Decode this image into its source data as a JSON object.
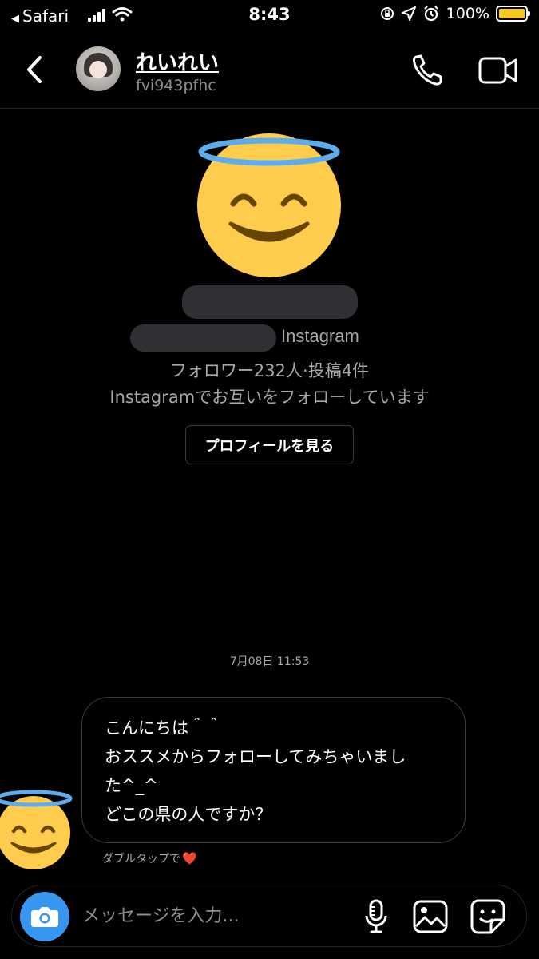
{
  "status_bar": {
    "back_app": "Safari",
    "time": "8:43",
    "battery_percent": "100%",
    "battery_level": 1.0,
    "battery_color": "#f7c820",
    "icons": [
      "back-triangle-icon",
      "signal-icon",
      "wifi-icon",
      "orientation-lock-icon",
      "location-icon",
      "alarm-icon",
      "battery-icon"
    ]
  },
  "header": {
    "display_name": "れいれい",
    "username": "fvi943pfhc",
    "icons": [
      "chevron-left-icon",
      "phone-icon",
      "video-camera-icon"
    ]
  },
  "profile": {
    "source_label": "Instagram",
    "stats": "フォロワー232人·投稿4件",
    "mutual": "Instagramでお互いをフォローしています",
    "view_profile_button": "プロフィールを見る",
    "emoji": "smiling-face-with-halo"
  },
  "messages": {
    "timestamp": "7月08日 11:53",
    "items": [
      {
        "lines": [
          "こんにちは＾＾",
          "おススメからフォローしてみちゃいまし",
          "た^_^",
          "どこの県の人ですか？"
        ]
      }
    ],
    "double_tap_hint": "ダブルタップで",
    "heart": "❤️"
  },
  "composer": {
    "placeholder": "メッセージを入力...",
    "value": "",
    "accent_color": "#3797f0",
    "icons": [
      "camera-icon",
      "microphone-icon",
      "image-icon",
      "sticker-icon"
    ]
  }
}
